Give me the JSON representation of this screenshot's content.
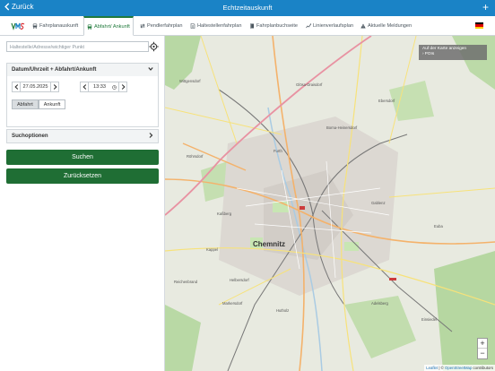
{
  "header": {
    "back_label": "Zurück",
    "title": "Echtzeitauskunft",
    "plus_label": "+"
  },
  "tabs": [
    {
      "label": "Fahrplanauskunft",
      "icon": "bus-icon",
      "active": false
    },
    {
      "label": "Abfahrt/ Ankunft",
      "icon": "stop-icon",
      "active": true
    },
    {
      "label": "Pendlerfahrplan",
      "icon": "commute-icon",
      "active": false
    },
    {
      "label": "Haltestellenfahrplan",
      "icon": "document-icon",
      "active": false
    },
    {
      "label": "Fahrplanbuchseite",
      "icon": "book-icon",
      "active": false
    },
    {
      "label": "Linienverlaufsplan",
      "icon": "route-icon",
      "active": false
    },
    {
      "label": "Aktuelle Meldungen",
      "icon": "warning-icon",
      "active": false
    }
  ],
  "search": {
    "placeholder": "Haltestelle/Adresse/wichtiger Punkt"
  },
  "datetime_panel": {
    "title": "Datum/Uhrzeit + Abfahrt/Ankunft",
    "date": "27.05.2025",
    "time": "13:33",
    "departure_label": "Abfahrt",
    "arrival_label": "Ankunft",
    "selected": "Abfahrt"
  },
  "options_panel": {
    "title": "Suchoptionen"
  },
  "buttons": {
    "search_label": "Suchen",
    "reset_label": "Zurücksetzen"
  },
  "map": {
    "pois_line1": "Auf der Karte anzeigen",
    "pois_line2": "POIs",
    "zoom_in": "+",
    "zoom_out": "−",
    "city": "Chemnitz",
    "places": [
      "Wittgensdorf",
      "Glösa-Draisdorf",
      "Ebersdorf",
      "Furth",
      "Borna-Heinersdorf",
      "Röhrsdorf",
      "Kaßberg",
      "Gablenz",
      "Kappel",
      "Helbersdorf",
      "Markersdorf",
      "Hutholz",
      "Einsiedel",
      "Reichenbrand",
      "Adelsberg",
      "Euba"
    ],
    "attribution_leaflet": "Leaflet",
    "attribution_sep": " | © ",
    "attribution_osm": "OpenStreetMap",
    "attribution_tail": " contributors"
  },
  "colors": {
    "header_blue": "#1a83c6",
    "accent_green": "#207a3c",
    "button_green": "#1f6e34"
  }
}
